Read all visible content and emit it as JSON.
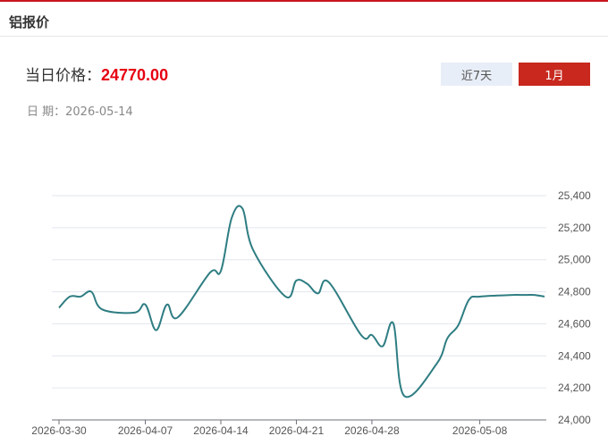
{
  "header": {
    "title": "铝报价"
  },
  "price": {
    "label": "当日价格：",
    "value": "24770.00"
  },
  "date": {
    "label": "日 期：",
    "value": "2026-05-14"
  },
  "range_buttons": {
    "week_label": "近7天",
    "month_label": "1月"
  },
  "colors": {
    "accent": "#c8161d",
    "line": "#2e7d82",
    "price": "#e60012"
  },
  "chart_data": {
    "type": "line",
    "title": "",
    "xlabel": "",
    "ylabel": "",
    "ylim": [
      24000,
      25400
    ],
    "y_ticks": [
      "24,000",
      "24,200",
      "24,400",
      "24,600",
      "24,800",
      "25,000",
      "25,200",
      "25,400"
    ],
    "x_tick_labels": [
      "2026-03-30",
      "2026-04-07",
      "2026-04-14",
      "2026-04-21",
      "2026-04-28",
      "2026-05-08"
    ],
    "axis_position": "right",
    "grid": true,
    "series": [
      {
        "x": [
          "2026-03-30",
          "2026-03-31",
          "2026-04-01",
          "2026-04-02",
          "2026-04-03",
          "2026-04-06",
          "2026-04-07",
          "2026-04-08",
          "2026-04-09",
          "2026-04-10",
          "2026-04-13",
          "2026-04-14",
          "2026-04-15",
          "2026-04-16",
          "2026-04-17",
          "2026-04-20",
          "2026-04-21",
          "2026-04-22",
          "2026-04-23",
          "2026-04-24",
          "2026-04-27",
          "2026-04-28",
          "2026-04-29",
          "2026-04-30",
          "2026-05-01",
          "2026-05-04",
          "2026-05-05",
          "2026-05-06",
          "2026-05-07",
          "2026-05-08",
          "2026-05-11",
          "2026-05-12",
          "2026-05-13",
          "2026-05-14"
        ],
        "values": [
          24700,
          24770,
          24770,
          24800,
          24690,
          24670,
          24720,
          24560,
          24720,
          24640,
          24920,
          24930,
          25260,
          25320,
          25060,
          24770,
          24870,
          24850,
          24790,
          24860,
          24530,
          24530,
          24460,
          24600,
          24150,
          24350,
          24510,
          24590,
          24750,
          24770,
          24780,
          24780,
          24780,
          24770
        ]
      }
    ]
  }
}
